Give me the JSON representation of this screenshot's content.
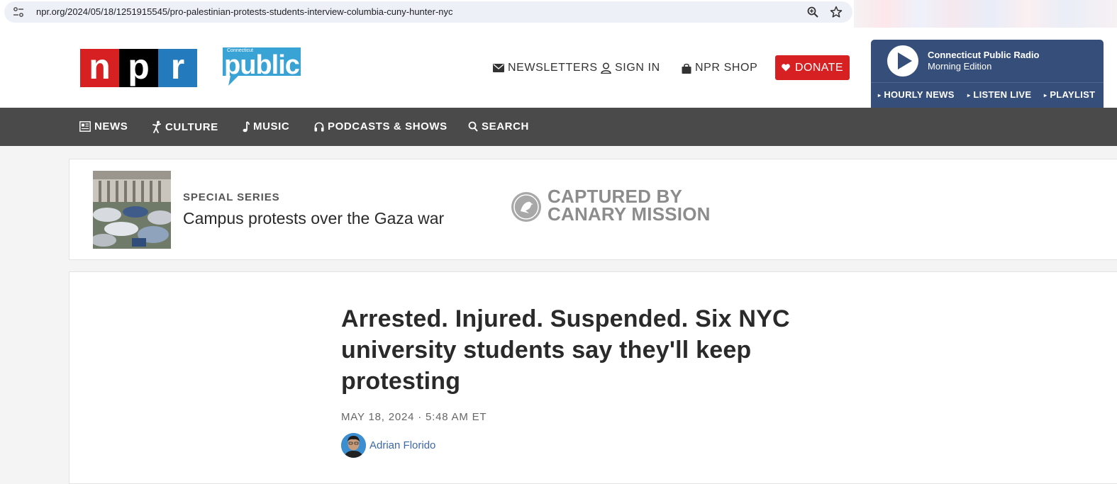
{
  "browser": {
    "url": "npr.org/2024/05/18/1251915545/pro-palestinian-protests-students-interview-columbia-cuny-hunter-nyc"
  },
  "header": {
    "npr_letters": [
      "n",
      "p",
      "r"
    ],
    "partner_small": "Connecticut",
    "partner_big": "public",
    "newsletters_label": "NEWSLETTERS",
    "signin_label": "SIGN IN",
    "shop_label": "NPR SHOP",
    "donate_label": "DONATE"
  },
  "player": {
    "station": "Connecticut Public Radio",
    "program": "Morning Edition",
    "links": [
      "HOURLY NEWS",
      "LISTEN LIVE",
      "PLAYLIST"
    ]
  },
  "main_nav": {
    "items": [
      "NEWS",
      "CULTURE",
      "MUSIC",
      "PODCASTS & SHOWS",
      "SEARCH"
    ]
  },
  "series": {
    "kicker": "SPECIAL SERIES",
    "title": "Campus protests over the Gaza war",
    "overlay_line1": "CAPTURED BY",
    "overlay_line2": "CANARY MISSION"
  },
  "article": {
    "headline": "Arrested. Injured. Suspended. Six NYC university students say they'll keep protesting",
    "dateline": "MAY 18, 2024 · 5:48 AM ET",
    "author": "Adrian Florido"
  },
  "colors": {
    "npr_red": "#d62021",
    "npr_blue": "#237bbd",
    "player_bg": "#364f7a",
    "nav_bg": "#4a4a4a",
    "author_link": "#3d68a8"
  },
  "icons": [
    "tune-icon",
    "zoom-icon",
    "star-icon",
    "envelope-icon",
    "person-icon",
    "bag-icon",
    "heart-icon",
    "play-icon",
    "news-icon",
    "culture-icon",
    "music-note-icon",
    "headphones-icon",
    "search-icon",
    "canary-bird-icon"
  ]
}
